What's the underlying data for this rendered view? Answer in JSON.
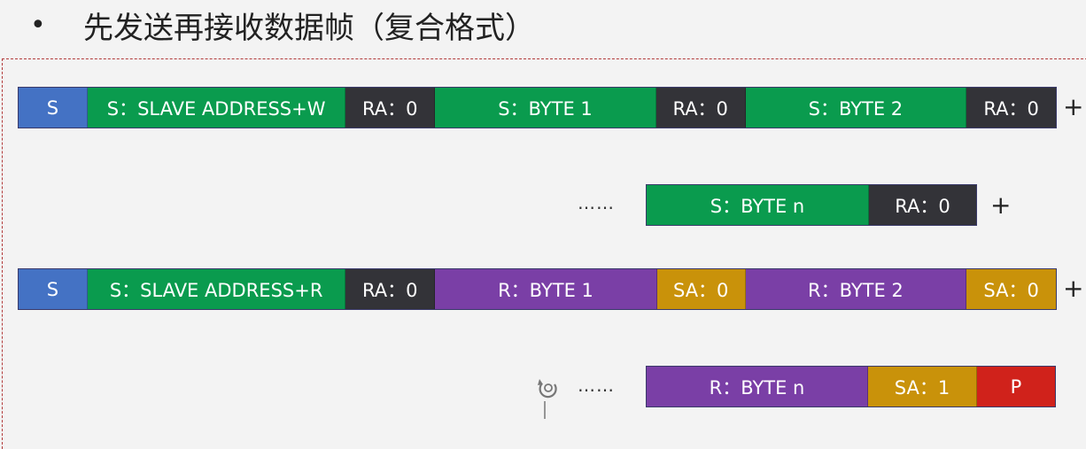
{
  "title": {
    "bullet": "•",
    "text": "先发送再接收数据帧（复合格式）"
  },
  "colors": {
    "start": "#4472c4",
    "send": "#0a9b4e",
    "ack_receive": "#333338",
    "receive": "#7a3fa6",
    "ack_send": "#c9920a",
    "stop": "#d0221b"
  },
  "rows": [
    {
      "cells": [
        {
          "label": "S",
          "color": "start"
        },
        {
          "label": "S：SLAVE ADDRESS+W",
          "color": "send"
        },
        {
          "label": "RA：0",
          "color": "ack_receive"
        },
        {
          "label": "S：BYTE 1",
          "color": "send"
        },
        {
          "label": "RA：0",
          "color": "ack_receive"
        },
        {
          "label": "S：BYTE 2",
          "color": "send"
        },
        {
          "label": "RA：0",
          "color": "ack_receive"
        }
      ],
      "suffix": "+"
    },
    {
      "prefix": "……",
      "cells": [
        {
          "label": "S：BYTE n",
          "color": "send"
        },
        {
          "label": "RA：0",
          "color": "ack_receive"
        }
      ],
      "suffix": "+"
    },
    {
      "cells": [
        {
          "label": "S",
          "color": "start"
        },
        {
          "label": "S：SLAVE ADDRESS+R",
          "color": "send"
        },
        {
          "label": "RA：0",
          "color": "ack_receive"
        },
        {
          "label": "R：BYTE 1",
          "color": "receive"
        },
        {
          "label": "SA：0",
          "color": "ack_send"
        },
        {
          "label": "R：BYTE 2",
          "color": "receive"
        },
        {
          "label": "SA：0",
          "color": "ack_send"
        }
      ],
      "suffix": "+"
    },
    {
      "prefix": "……",
      "cells": [
        {
          "label": "R：BYTE n",
          "color": "receive"
        },
        {
          "label": "SA：1",
          "color": "ack_send"
        },
        {
          "label": "P",
          "color": "stop"
        }
      ]
    }
  ]
}
